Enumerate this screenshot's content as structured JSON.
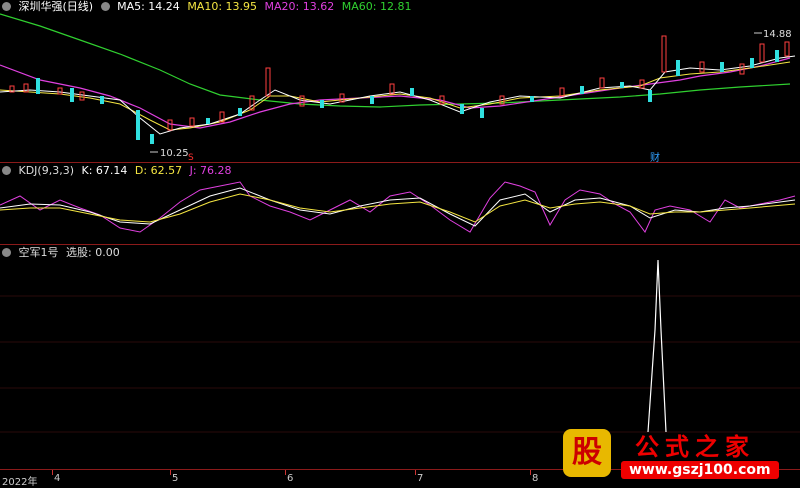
{
  "main_panel": {
    "title": "深圳华强(日线)",
    "ma": [
      {
        "label": "MA5: 14.24",
        "color": "#ffffff"
      },
      {
        "label": "MA10: 13.95",
        "color": "#f5e642"
      },
      {
        "label": "MA20: 13.62",
        "color": "#e040e0"
      },
      {
        "label": "MA60: 12.81",
        "color": "#30d030"
      }
    ],
    "high_label": "14.88",
    "low_label": "10.25",
    "marker_s": "S",
    "marker_cai": "财"
  },
  "kdj_panel": {
    "title": "KDJ(9,3,3)",
    "k": "K: 67.14",
    "d": "D: 62.57",
    "j": "J: 76.28",
    "colors": {
      "k": "#ffffff",
      "d": "#f5e642",
      "j": "#e040e0"
    }
  },
  "signal_panel": {
    "title": "空军1号",
    "value": "选股: 0.00"
  },
  "x_axis": {
    "labels": [
      "2022年",
      "4",
      "5",
      "6",
      "7",
      "8"
    ]
  },
  "watermark": {
    "logo": "股",
    "name": "公式之家",
    "url": "www.gszj100.com"
  }
}
